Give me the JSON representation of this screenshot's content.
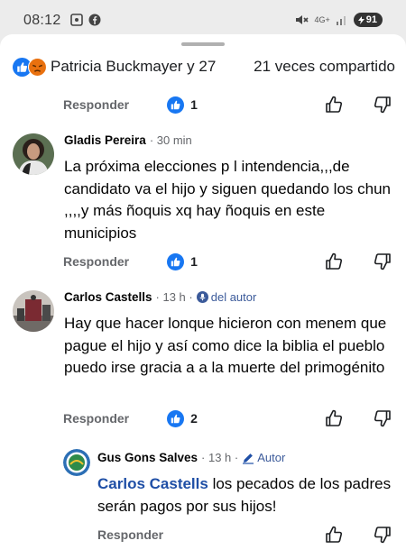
{
  "status_bar": {
    "time": "08:12",
    "network": "4G+",
    "battery": "91"
  },
  "reactions": {
    "names": "Patricia Buckmayer y 27",
    "shares": "21 veces compartido"
  },
  "post_actions": {
    "reply": "Responder",
    "likes": "1"
  },
  "comments": [
    {
      "author": "Gladis Pereira",
      "time": "· 30 min",
      "text": "La próxima elecciones p l intendencia,,,de candidato va el hijo y siguen quedando los chun ,,,,y más ñoquis xq hay ñoquis en este municipios",
      "reply": "Responder",
      "likes": "1"
    },
    {
      "author": "Carlos Castells",
      "time": "· 13 h ·",
      "badge": "del autor",
      "text": "Hay que hacer lonque hicieron con menem que pague el hijo y así como dice la biblia el pueblo puedo irse gracia a a la muerte del primogénito",
      "reply": "Responder",
      "likes": "2"
    }
  ],
  "reply": {
    "author": "Gus Gons Salves",
    "time": "· 13 h ·",
    "badge": "Autor",
    "mention": "Carlos Castells",
    "text": " los pecados de los padres serán pagos por sus hijos!",
    "reply": "Responder"
  },
  "colors": {
    "like_blue": "#1877f2",
    "angry": "#e9710f",
    "muted": "#65676b"
  }
}
